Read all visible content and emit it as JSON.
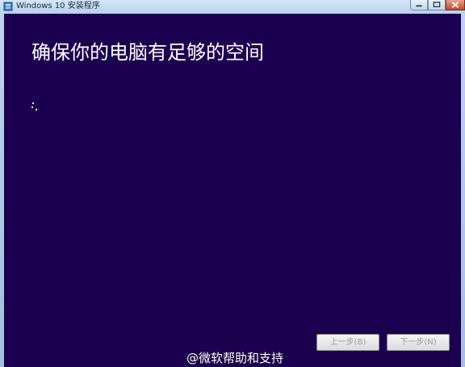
{
  "window": {
    "title": "Windows 10 安装程序",
    "caption_buttons": {
      "minimize": "minimize",
      "maximize": "maximize",
      "close": "close"
    }
  },
  "page": {
    "heading": "确保你的电脑有足够的空间",
    "background_color": "#1c0050"
  },
  "buttons": {
    "back_label": "上一步(B)",
    "next_label": "下一步(N)",
    "back_enabled": false,
    "next_enabled": false
  },
  "watermark": {
    "text": "@微软帮助和支持"
  },
  "icons": {
    "app": "setup-icon",
    "busy": "loading-spinner-icon"
  }
}
